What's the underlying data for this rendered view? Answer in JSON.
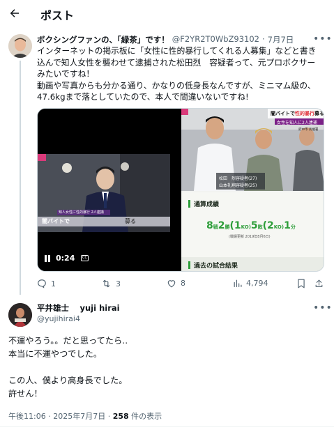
{
  "header": {
    "title": "ポスト",
    "back_icon": "arrow-left-icon"
  },
  "tweet1": {
    "name": "ボクシングファンの、「緑茶」です！",
    "handle": "@F2YR2T0WbZ93102",
    "separator": "·",
    "date": "7月7日",
    "more_icon": "more-horizontal-icon",
    "body": [
      "インターネットの掲示板に「女性に性的暴行してくれる人募集」などと書き",
      "込んで知人女性を襲わせて逮捕された松田烈　容疑者って、元プロボクサー",
      "みたいですね！",
      "動画や写真からも分かる通り、かなりの低身長なんですが、ミニマム級の、",
      "47.6kgまで落としていたので、本人で間違いないですね!"
    ],
    "media": {
      "video": {
        "time": "0:24",
        "caption_badge": "知人女性に性的暴行 2人逮捕",
        "caption_bar": "闇バイトで",
        "caption_tail": "募る"
      },
      "photo": {
        "headline_pre": "闇バイトで",
        "headline_red": "性的暴行",
        "headline_post": "募る",
        "sub_badge": "女性を知人に2人逮捕",
        "name_label_1": "松田　烈容疑者(27)",
        "name_label_2": "山本礼翔容疑者(25)",
        "corner_text": "府中市 高幡署"
      },
      "stats": {
        "section_title": "通算成績",
        "record": [
          {
            "num": "8",
            "unit": "戦"
          },
          {
            "num": "2",
            "unit": "勝"
          },
          {
            "num": "(1",
            "unit": "KO)"
          },
          {
            "num": "5",
            "unit": "敗"
          },
          {
            "num": "(2",
            "unit": "KO)"
          },
          {
            "num": "1",
            "unit": "分"
          }
        ],
        "update_note": "(戦績更新 2019年8月6日)",
        "section_title_2": "過去の試合結果"
      }
    },
    "actions": {
      "reply_count": "1",
      "retweet_count": "3",
      "like_count": "8",
      "views_count": "4,794"
    }
  },
  "tweet2": {
    "name": "平井雄士　 yuji hirai",
    "handle": "@yujihirai4",
    "more_icon": "more-horizontal-icon",
    "body": [
      "不運やろう。。だと思ってたら‥",
      "本当に不運やつでした。",
      "",
      "この人、僕より高身長でした。",
      "許せん！"
    ],
    "meta": {
      "time": "午後11:06",
      "separator": "·",
      "date": "2025年7月7日",
      "views_num": "258",
      "views_label": "件の表示"
    }
  },
  "colors": {
    "text_primary": "#0f1419",
    "text_secondary": "#536471",
    "border": "#cfd9de",
    "stats_green": "#2e9e3a",
    "headline_red": "#e0303a"
  }
}
